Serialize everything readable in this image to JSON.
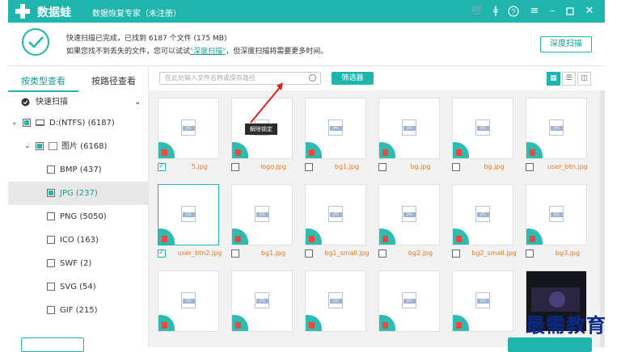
{
  "titlebar": {
    "app_name": "数据蛙",
    "app_sub": "数据恢复专家（未注册）",
    "icons": [
      "cart-icon",
      "key-icon",
      "help-icon",
      "menu-icon",
      "minimize-icon",
      "maximize-icon",
      "close-icon"
    ],
    "color": "#1fb5ac"
  },
  "info": {
    "line1": "快速扫描已完成，已找到 6187 个文件 (175 MB)",
    "line2_prefix": "如果您找不到丢失的文件，您可以试试",
    "line2_link": "\"深度扫描\"",
    "line2_suffix": "，但深度扫描将需要更多时间。",
    "deep_scan_label": "深度扫描"
  },
  "sidebar": {
    "tabs": [
      "按类型查看",
      "按路径查看"
    ],
    "active_tab": 0,
    "quick_scan_label": "快速扫描",
    "drive_label": "D:(NTFS) (6187)",
    "pictures_label": "图片 (6168)",
    "types": [
      {
        "label": "BMP (437)"
      },
      {
        "label": "JPG (237)"
      },
      {
        "label": "PNG (5050)"
      },
      {
        "label": "ICO (163)"
      },
      {
        "label": "SWF (2)"
      },
      {
        "label": "SVG (54)"
      },
      {
        "label": "GIF (215)"
      }
    ],
    "selected_type": 1
  },
  "toolbar": {
    "search_placeholder": "在此处输入文件名称或保存路径",
    "filter_label": "筛选器",
    "view_modes": [
      "grid-view-icon",
      "list-view-icon",
      "detail-view-icon"
    ]
  },
  "tooltip": "解除锁定",
  "files": {
    "row1": [
      {
        "name": "5.jpg",
        "checked": true
      },
      {
        "name": "logo.jpg",
        "checked": false
      },
      {
        "name": "bg1.jpg",
        "checked": false
      },
      {
        "name": "bg.jpg",
        "checked": false
      },
      {
        "name": "bg.jpg",
        "checked": false
      },
      {
        "name": "user_btn.jpg",
        "checked": false
      }
    ],
    "row2": [
      {
        "name": "user_btn2.jpg",
        "checked": true
      },
      {
        "name": "bg1.jpg",
        "checked": false
      },
      {
        "name": "bg1_small.jpg",
        "checked": false
      },
      {
        "name": "bg2.jpg",
        "checked": false
      },
      {
        "name": "bg2_small.jpg",
        "checked": false
      },
      {
        "name": "bg3.jpg",
        "checked": false
      }
    ]
  },
  "watermark": "最需教育"
}
